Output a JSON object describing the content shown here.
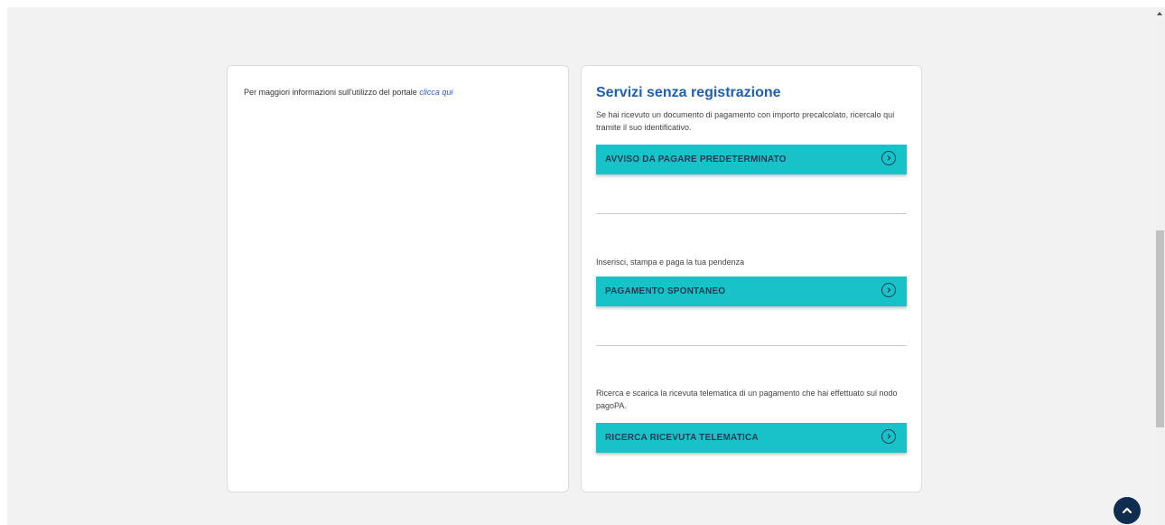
{
  "left_card": {
    "info_text": "Per maggiori informazioni sull'utilizzo del portale",
    "info_link": "clicca qui"
  },
  "right_card": {
    "title": "Servizi senza registrazione",
    "sections": [
      {
        "description": "Se hai ricevuto un documento di pagamento con importo precalcolato, ricercalo qui tramite il suo identificativo.",
        "button_label": "AVVISO DA PAGARE PREDETERMINATO"
      },
      {
        "description": "Inserisci, stampa e paga la tua pendenza",
        "button_label": "PAGAMENTO SPONTANEO"
      },
      {
        "description": "Ricerca e scarica la ricevuta telematica di un pagamento che hai effettuato sul nodo pagoPA.",
        "button_label": "RICERCA RICEVUTA TELEMATICA"
      }
    ]
  },
  "icons": {
    "button_arrow": "chevron-right-circle-icon",
    "back_to_top": "chevron-up-icon"
  },
  "colors": {
    "button_bg": "#17c2c9",
    "title": "#1c5fb8",
    "link": "#2a5bd7",
    "back_to_top_bg": "#0f2d4f"
  }
}
